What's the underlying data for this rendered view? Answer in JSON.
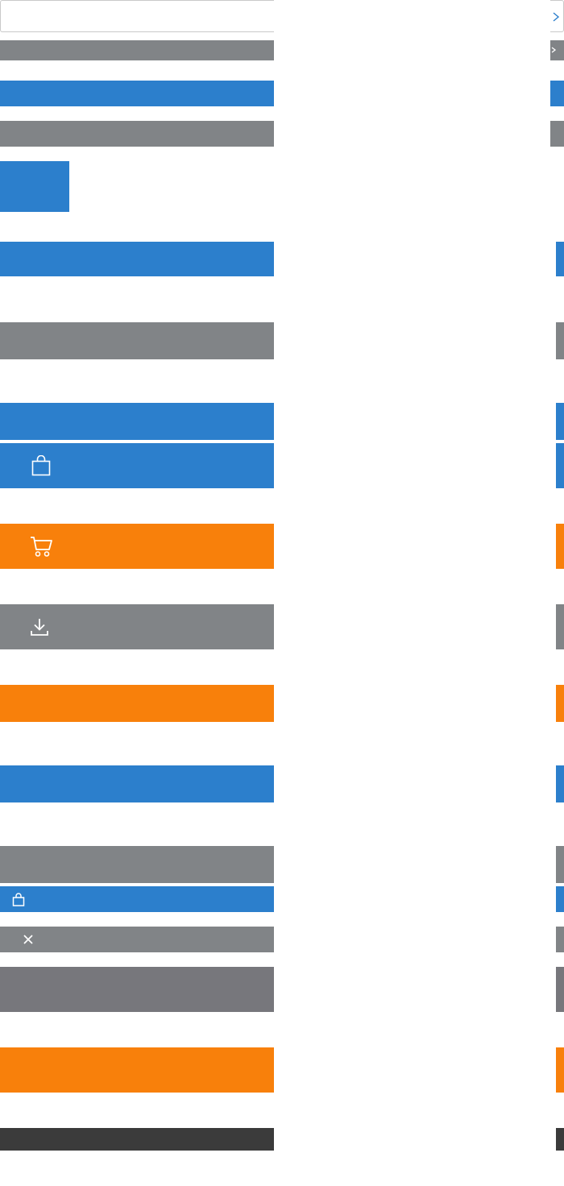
{
  "search": {
    "value": "",
    "placeholder": "",
    "submit_icon": "chevron-right-icon"
  },
  "buttons": [
    {
      "id": "gray-small-1",
      "label": "",
      "style": "gray"
    },
    {
      "id": "blue-small-1",
      "label": "",
      "style": "blue"
    },
    {
      "id": "gray-small-2",
      "label": "",
      "style": "gray"
    },
    {
      "id": "blue-square",
      "label": "",
      "style": "blue"
    },
    {
      "id": "blue-large-1",
      "label": "",
      "style": "blue"
    },
    {
      "id": "gray-large-1",
      "label": "",
      "style": "gray"
    },
    {
      "id": "blue-large-2",
      "label": "",
      "style": "blue"
    },
    {
      "id": "blue-bag",
      "label": "",
      "style": "blue",
      "icon": "shopping-bag-icon"
    },
    {
      "id": "orange-cart",
      "label": "",
      "style": "orange",
      "icon": "shopping-cart-icon"
    },
    {
      "id": "gray-download",
      "label": "",
      "style": "gray",
      "icon": "download-icon"
    },
    {
      "id": "orange-large-1",
      "label": "",
      "style": "orange"
    },
    {
      "id": "blue-large-3",
      "label": "",
      "style": "blue"
    },
    {
      "id": "gray-large-2",
      "label": "",
      "style": "gray"
    },
    {
      "id": "blue-small-bag",
      "label": "",
      "style": "blue",
      "icon": "shopping-bag-icon"
    },
    {
      "id": "gray-small-close",
      "label": "",
      "style": "gray",
      "icon": "close-icon"
    },
    {
      "id": "slate-large",
      "label": "",
      "style": "slate"
    },
    {
      "id": "orange-large-2",
      "label": "",
      "style": "orange"
    },
    {
      "id": "dark-small",
      "label": "",
      "style": "dark"
    }
  ],
  "colors": {
    "blue": "#2c7fcc",
    "gray": "#818487",
    "orange": "#f8800b",
    "slate": "#77777c",
    "dark": "#3b3b3b",
    "border": "#c9c9c9"
  }
}
